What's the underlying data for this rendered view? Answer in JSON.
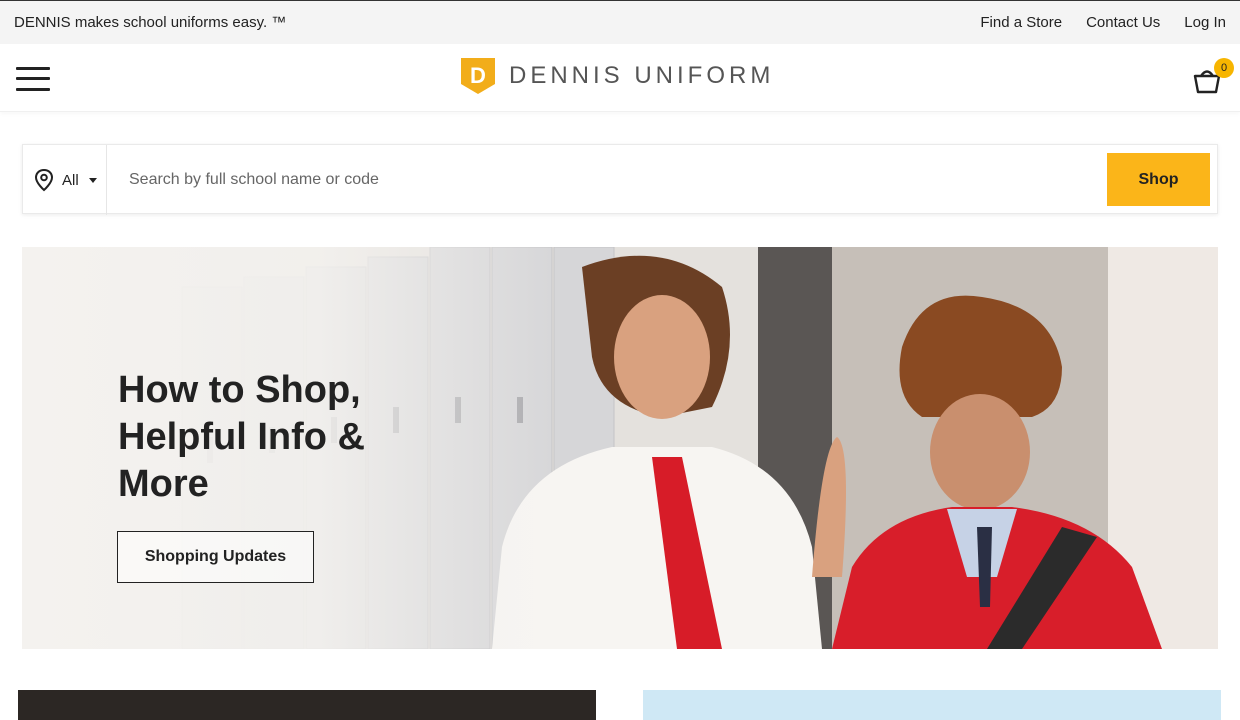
{
  "topbar": {
    "tagline": "DENNIS makes school uniforms easy. ™",
    "links": [
      "Find a Store",
      "Contact Us",
      "Log In"
    ]
  },
  "header": {
    "logo_letter": "D",
    "logo_text": "DENNIS UNIFORM",
    "cart_count": "0"
  },
  "search": {
    "location_label": "All",
    "placeholder": "Search by full school name or code",
    "button_label": "Shop"
  },
  "hero": {
    "title": "How to Shop, Helpful Info & More",
    "button_label": "Shopping Updates"
  },
  "colors": {
    "accent": "#fbb519",
    "logo_badge": "#f2ad1a",
    "topbar_bg": "#f4f4f4",
    "text": "#222222"
  },
  "icons": [
    "menu-icon",
    "cart-icon",
    "location-pin-icon",
    "caret-down-icon",
    "logo-badge-icon"
  ]
}
